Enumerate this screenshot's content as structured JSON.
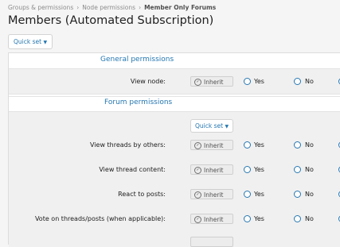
{
  "breadcrumbs": [
    {
      "label": "Groups & permissions"
    },
    {
      "label": "Node permissions"
    },
    {
      "label": "Member Only Forums"
    }
  ],
  "page_title": "Members (Automated Subscription)",
  "quick_set_label": "Quick set",
  "option_labels": {
    "inherit": "Inherit",
    "yes": "Yes",
    "no": "No"
  },
  "sections": {
    "general": {
      "title": "General permissions",
      "rows": [
        {
          "label": "View node:"
        }
      ]
    },
    "forum": {
      "title": "Forum permissions",
      "quick_set_label": "Quick set",
      "rows": [
        {
          "label": "View threads by others:"
        },
        {
          "label": "View thread content:"
        },
        {
          "label": "React to posts:"
        },
        {
          "label": "Vote on threads/posts (when applicable):"
        }
      ]
    }
  },
  "accent_color": "#2577b1"
}
